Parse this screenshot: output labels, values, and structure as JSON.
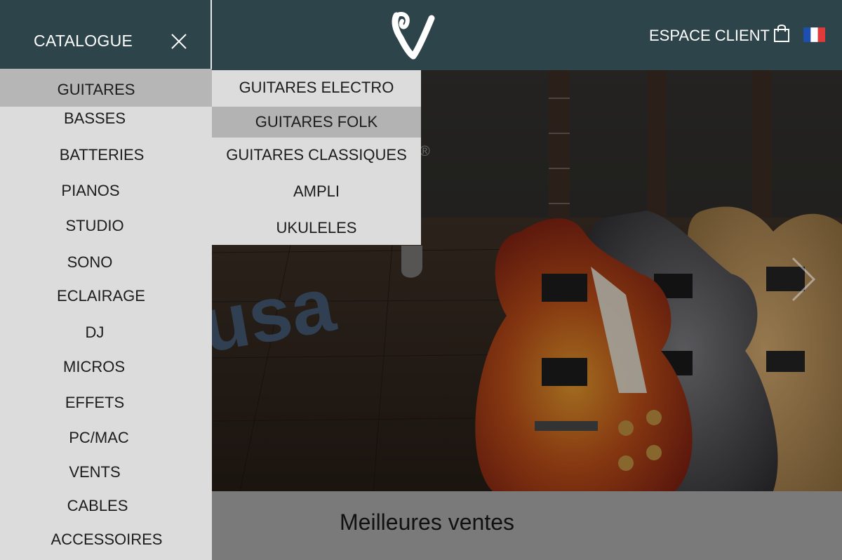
{
  "header": {
    "catalogue_title": "CATALOGUE",
    "account_label": "ESPACE CLIENT"
  },
  "menu": {
    "items": [
      {
        "label": "GUITARES"
      },
      {
        "label": "BASSES"
      },
      {
        "label": "BATTERIES"
      },
      {
        "label": "PIANOS"
      },
      {
        "label": "STUDIO"
      },
      {
        "label": "SONO"
      },
      {
        "label": "ECLAIRAGE"
      },
      {
        "label": "DJ"
      },
      {
        "label": "MICROS"
      },
      {
        "label": "EFFETS"
      },
      {
        "label": "PC/MAC"
      },
      {
        "label": "VENTS"
      },
      {
        "label": "CABLES"
      },
      {
        "label": "ACCESSOIRES"
      }
    ]
  },
  "submenu": {
    "items": [
      {
        "label": "GUITARES ELECTRO"
      },
      {
        "label": "GUITARES FOLK"
      },
      {
        "label": "GUITARES CLASSIQUES"
      },
      {
        "label": "AMPLI"
      },
      {
        "label": "UKULELES"
      }
    ]
  },
  "hero": {
    "brand_text": "usa",
    "registered_mark": "®"
  },
  "best_sellers": {
    "title": "Meilleures ventes"
  },
  "colors": {
    "header_bg": "#2d444a",
    "menu_bg": "#dcdcdc",
    "menu_active_bg": "#b6b6b6",
    "best_sellers_bg": "#7a7a7a"
  },
  "icons": {
    "close": "close-icon",
    "cart": "shopping-bag-icon",
    "flag": "french-flag-icon",
    "next": "chevron-right-icon"
  }
}
